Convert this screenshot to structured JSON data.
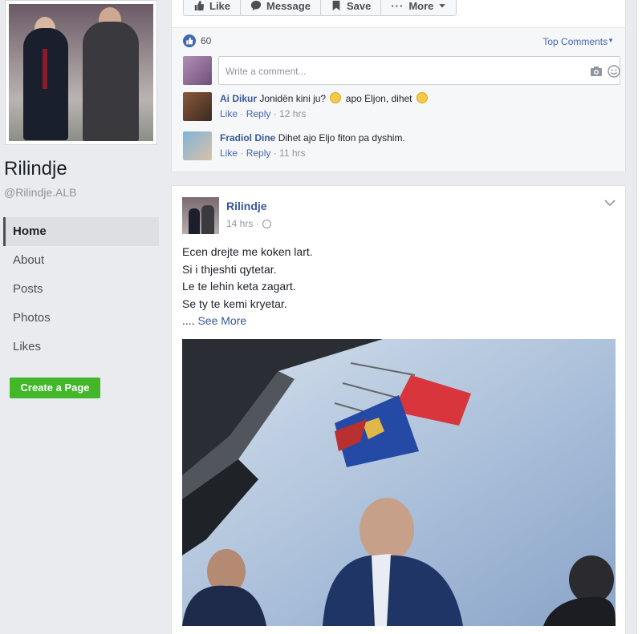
{
  "page": {
    "name": "Rilindje",
    "handle": "@Rilindje.ALB"
  },
  "nav": {
    "items": [
      {
        "label": "Home",
        "active": true
      },
      {
        "label": "About"
      },
      {
        "label": "Posts"
      },
      {
        "label": "Photos"
      },
      {
        "label": "Likes"
      }
    ],
    "create_page": "Create a Page"
  },
  "action_bar": {
    "like": "Like",
    "message": "Message",
    "save": "Save",
    "more": "More"
  },
  "reactions": {
    "count": "60",
    "top_comments": "Top Comments"
  },
  "composer": {
    "placeholder": "Write a comment..."
  },
  "comments": [
    {
      "author": "Ai Dikur",
      "text_a": "Jonidën kini ju?",
      "text_b": "apo Eljon, dihet",
      "like": "Like",
      "reply": "Reply",
      "time": "12 hrs"
    },
    {
      "author": "Fradiol Dine",
      "text": "Dihet ajo Eljo fiton pa dyshim.",
      "like": "Like",
      "reply": "Reply",
      "time": "11 hrs"
    }
  ],
  "post": {
    "author": "Rilindje",
    "time": "14 hrs",
    "lines": [
      "Ecen drejte me koken lart.",
      "Si i thjeshti qytetar.",
      "Le te lehin keta zagart.",
      "Se ty te kemi kryetar."
    ],
    "see_more_prefix": "....",
    "see_more": "See More"
  },
  "colors": {
    "link": "#365899",
    "accent": "#4267b2",
    "green": "#42b72a",
    "background": "#e9ebee"
  }
}
